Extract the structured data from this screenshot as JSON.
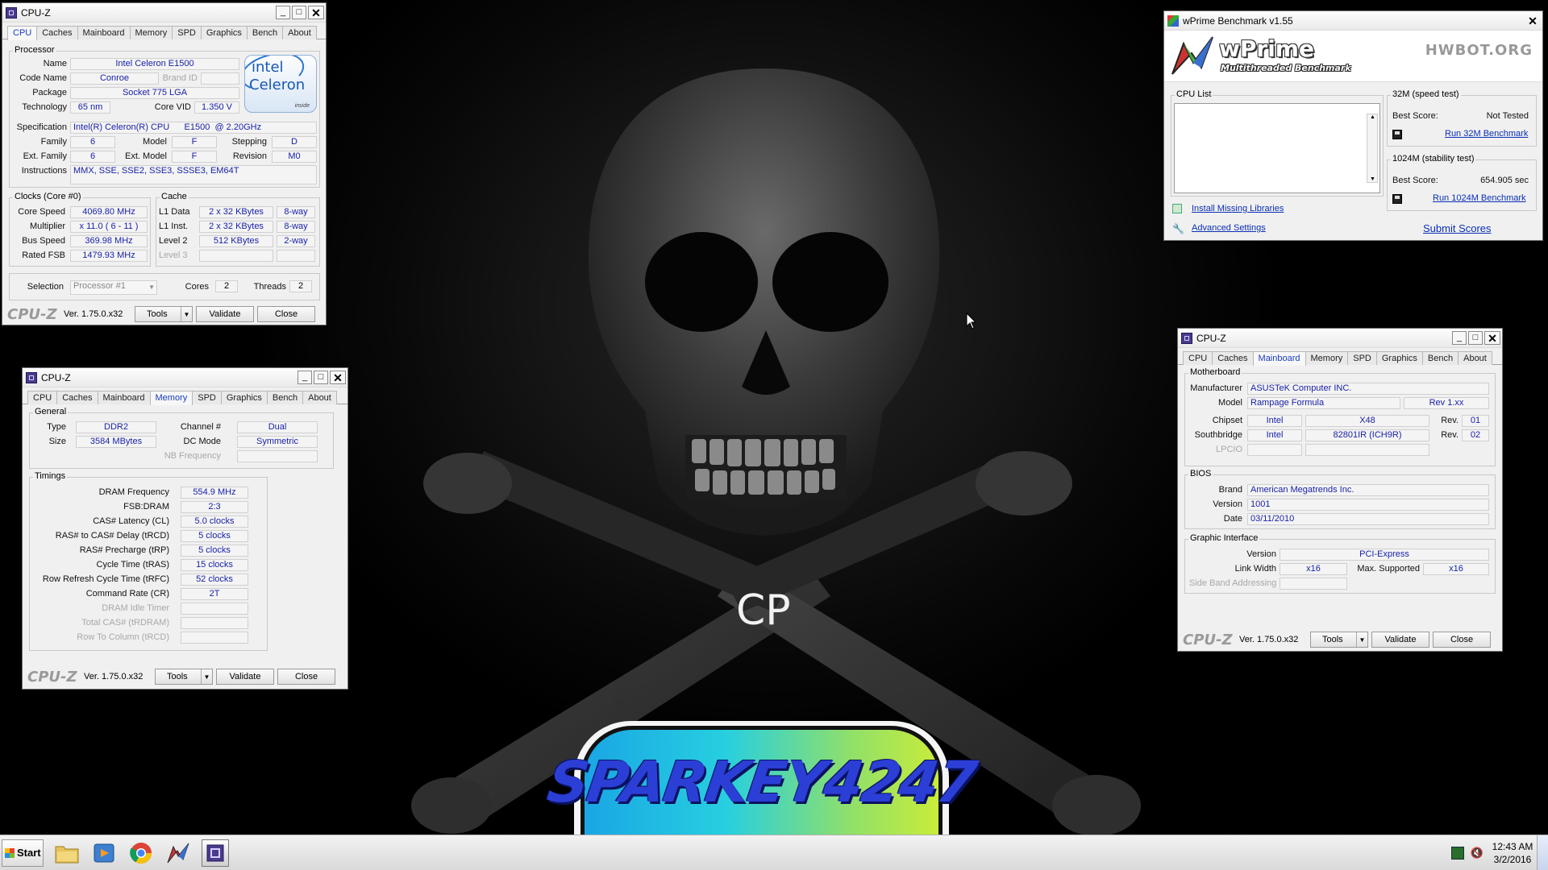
{
  "desktop": {
    "center_text": "CP",
    "badge_text": "SPARKEY4247"
  },
  "taskbar": {
    "start_label": "Start",
    "time": "12:43 AM",
    "date": "3/2/2016"
  },
  "cpuz_cpu": {
    "title": "CPU-Z",
    "tabs": [
      "CPU",
      "Caches",
      "Mainboard",
      "Memory",
      "SPD",
      "Graphics",
      "Bench",
      "About"
    ],
    "active_tab": "CPU",
    "processor": {
      "group": "Processor",
      "name_label": "Name",
      "name": "Intel Celeron E1500",
      "codename_label": "Code Name",
      "codename": "Conroe",
      "brandid_label": "Brand ID",
      "package_label": "Package",
      "package": "Socket 775 LGA",
      "technology_label": "Technology",
      "technology": "65 nm",
      "corevid_label": "Core VID",
      "corevid": "1.350 V",
      "spec_label": "Specification",
      "spec": "Intel(R) Celeron(R) CPU      E1500  @ 2.20GHz",
      "family_label": "Family",
      "family": "6",
      "model_label": "Model",
      "model": "F",
      "stepping_label": "Stepping",
      "stepping": "D",
      "extfamily_label": "Ext. Family",
      "extfamily": "6",
      "extmodel_label": "Ext. Model",
      "extmodel": "F",
      "revision_label": "Revision",
      "revision": "M0",
      "instructions_label": "Instructions",
      "instructions": "MMX, SSE, SSE2, SSE3, SSSE3, EM64T"
    },
    "intel_logo": {
      "brand": "intel",
      "line": "Celeron",
      "tag": "inside"
    },
    "clocks": {
      "group": "Clocks (Core #0)",
      "corespeed_label": "Core Speed",
      "corespeed": "4069.80 MHz",
      "multiplier_label": "Multiplier",
      "multiplier": "x 11.0 ( 6 - 11 )",
      "busspeed_label": "Bus Speed",
      "busspeed": "369.98 MHz",
      "ratedfsb_label": "Rated FSB",
      "ratedfsb": "1479.93 MHz"
    },
    "cache": {
      "group": "Cache",
      "l1d_label": "L1 Data",
      "l1d": "2 x 32 KBytes",
      "l1d_way": "8-way",
      "l1i_label": "L1 Inst.",
      "l1i": "2 x 32 KBytes",
      "l1i_way": "8-way",
      "l2_label": "Level 2",
      "l2": "512 KBytes",
      "l2_way": "2-way",
      "l3_label": "Level 3"
    },
    "selection_label": "Selection",
    "selection": "Processor #1",
    "cores_label": "Cores",
    "cores": "2",
    "threads_label": "Threads",
    "threads": "2",
    "footer": {
      "logo": "CPU-Z",
      "version": "Ver. 1.75.0.x32",
      "tools": "Tools",
      "validate": "Validate",
      "close": "Close"
    }
  },
  "cpuz_memory": {
    "title": "CPU-Z",
    "tabs": [
      "CPU",
      "Caches",
      "Mainboard",
      "Memory",
      "SPD",
      "Graphics",
      "Bench",
      "About"
    ],
    "active_tab": "Memory",
    "general": {
      "group": "General",
      "type_label": "Type",
      "type": "DDR2",
      "size_label": "Size",
      "size": "3584 MBytes",
      "channel_label": "Channel #",
      "channel": "Dual",
      "dcmode_label": "DC Mode",
      "dcmode": "Symmetric",
      "nbfreq_label": "NB Frequency"
    },
    "timings": {
      "group": "Timings",
      "rows": [
        {
          "label": "DRAM Frequency",
          "value": "554.9 MHz",
          "enabled": true
        },
        {
          "label": "FSB:DRAM",
          "value": "2:3",
          "enabled": true
        },
        {
          "label": "CAS# Latency (CL)",
          "value": "5.0 clocks",
          "enabled": true
        },
        {
          "label": "RAS# to CAS# Delay (tRCD)",
          "value": "5 clocks",
          "enabled": true
        },
        {
          "label": "RAS# Precharge (tRP)",
          "value": "5 clocks",
          "enabled": true
        },
        {
          "label": "Cycle Time (tRAS)",
          "value": "15 clocks",
          "enabled": true
        },
        {
          "label": "Row Refresh Cycle Time (tRFC)",
          "value": "52 clocks",
          "enabled": true
        },
        {
          "label": "Command Rate (CR)",
          "value": "2T",
          "enabled": true
        },
        {
          "label": "DRAM Idle Timer",
          "value": "",
          "enabled": false
        },
        {
          "label": "Total CAS# (tRDRAM)",
          "value": "",
          "enabled": false
        },
        {
          "label": "Row To Column (tRCD)",
          "value": "",
          "enabled": false
        }
      ]
    },
    "footer": {
      "logo": "CPU-Z",
      "version": "Ver. 1.75.0.x32",
      "tools": "Tools",
      "validate": "Validate",
      "close": "Close"
    }
  },
  "cpuz_mainboard": {
    "title": "CPU-Z",
    "tabs": [
      "CPU",
      "Caches",
      "Mainboard",
      "Memory",
      "SPD",
      "Graphics",
      "Bench",
      "About"
    ],
    "active_tab": "Mainboard",
    "motherboard": {
      "group": "Motherboard",
      "manufacturer_label": "Manufacturer",
      "manufacturer": "ASUSTeK Computer INC.",
      "model_label": "Model",
      "model": "Rampage Formula",
      "model_rev": "Rev 1.xx",
      "chipset_label": "Chipset",
      "chipset_vendor": "Intel",
      "chipset": "X48",
      "chipset_rev_label": "Rev.",
      "chipset_rev": "01",
      "south_label": "Southbridge",
      "south_vendor": "Intel",
      "south": "82801IR (ICH9R)",
      "south_rev_label": "Rev.",
      "south_rev": "02",
      "lpcio_label": "LPCIO"
    },
    "bios": {
      "group": "BIOS",
      "brand_label": "Brand",
      "brand": "American Megatrends Inc.",
      "version_label": "Version",
      "version": "1001",
      "date_label": "Date",
      "date": "03/11/2010"
    },
    "graphic": {
      "group": "Graphic Interface",
      "version_label": "Version",
      "version": "PCI-Express",
      "linkwidth_label": "Link Width",
      "linkwidth": "x16",
      "maxsup_label": "Max. Supported",
      "maxsup": "x16",
      "sideband_label": "Side Band Addressing"
    },
    "footer": {
      "logo": "CPU-Z",
      "version": "Ver. 1.75.0.x32",
      "tools": "Tools",
      "validate": "Validate",
      "close": "Close"
    }
  },
  "wprime": {
    "title": "wPrime Benchmark v1.55",
    "logo": "wPrime",
    "subtitle": "Multithreaded Benchmark",
    "partner": "HWBOT.ORG",
    "cpu_list_label": "CPU List",
    "test32": {
      "group": "32M (speed test)",
      "best_label": "Best Score:",
      "best": "Not Tested",
      "run": "Run 32M Benchmark"
    },
    "test1024": {
      "group": "1024M (stability test)",
      "best_label": "Best Score:",
      "best": "654.905 sec",
      "run": "Run 1024M Benchmark"
    },
    "install_link": "Install Missing Libraries",
    "advanced_link": "Advanced Settings",
    "submit_link": "Submit Scores"
  }
}
